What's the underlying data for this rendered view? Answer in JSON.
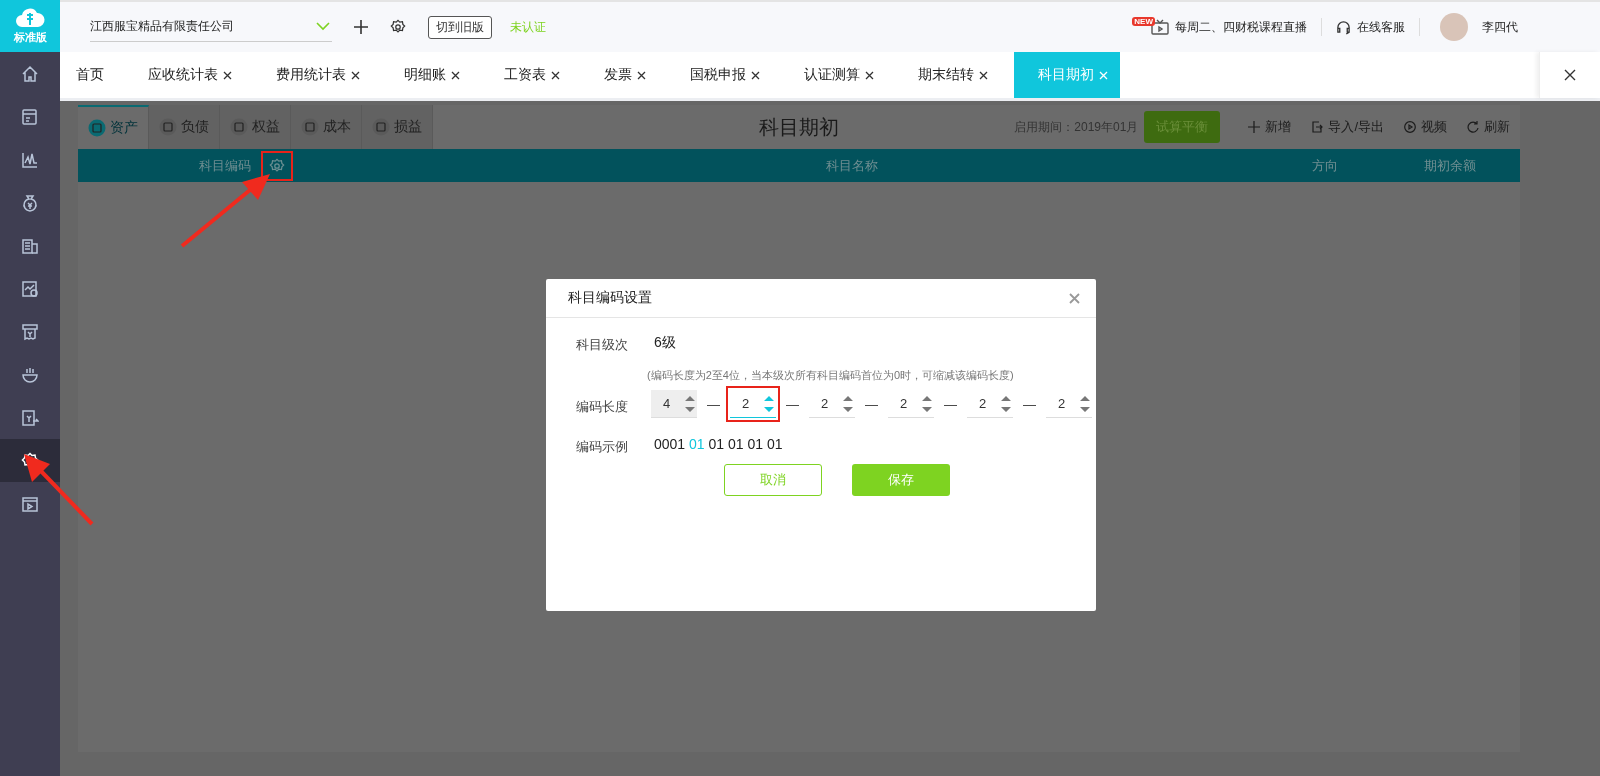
{
  "logo": {
    "label": "标准版"
  },
  "header": {
    "company": "江西服宝精品有限责任公司",
    "switch_button": "切到旧版",
    "auth_status": "未认证",
    "live_badge": "NEW",
    "live_text": "每周二、四财税课程直播",
    "service": "在线客服",
    "user": "李四代"
  },
  "sidebar": {
    "items": [
      {
        "selected": false
      },
      {
        "selected": false
      },
      {
        "selected": false
      },
      {
        "selected": false
      },
      {
        "selected": false
      },
      {
        "selected": false
      },
      {
        "selected": false
      },
      {
        "selected": false
      },
      {
        "selected": false
      },
      {
        "selected": true
      },
      {
        "selected": false
      }
    ]
  },
  "tabs": [
    {
      "label": "首页",
      "closable": false,
      "selected": false
    },
    {
      "label": "应收统计表",
      "closable": true,
      "selected": false
    },
    {
      "label": "费用统计表",
      "closable": true,
      "selected": false
    },
    {
      "label": "明细账",
      "closable": true,
      "selected": false
    },
    {
      "label": "工资表",
      "closable": true,
      "selected": false
    },
    {
      "label": "发票",
      "closable": true,
      "selected": false
    },
    {
      "label": "国税申报",
      "closable": true,
      "selected": false
    },
    {
      "label": "认证测算",
      "closable": true,
      "selected": false
    },
    {
      "label": "期末结转",
      "closable": true,
      "selected": false
    },
    {
      "label": "科目期初",
      "closable": true,
      "selected": true
    }
  ],
  "category_tabs": [
    {
      "label": "资产",
      "selected": true
    },
    {
      "label": "负债",
      "selected": false
    },
    {
      "label": "权益",
      "selected": false
    },
    {
      "label": "成本",
      "selected": false
    },
    {
      "label": "损益",
      "selected": false
    }
  ],
  "page_title": "科目期初",
  "toolbar": {
    "period": "启用期间：2019年01月",
    "balance_button": "试算平衡",
    "actions": [
      "新增",
      "导入/导出",
      "视频",
      "刷新"
    ]
  },
  "table": {
    "columns": [
      "科目编码",
      "科目名称",
      "方向",
      "期初余额"
    ]
  },
  "dialog": {
    "title": "科目编码设置",
    "level_label": "科目级次",
    "level_value": "6级",
    "hint": "(编码长度为2至4位，当本级次所有科目编码首位为0时，可缩减该编码长度)",
    "length_label": "编码长度",
    "separator": "—",
    "lengths": [
      {
        "value": "4",
        "disabled": true,
        "focused": false
      },
      {
        "value": "2",
        "disabled": false,
        "focused": true
      },
      {
        "value": "2",
        "disabled": false,
        "focused": false
      },
      {
        "value": "2",
        "disabled": false,
        "focused": false
      },
      {
        "value": "2",
        "disabled": false,
        "focused": false
      },
      {
        "value": "2",
        "disabled": false,
        "focused": false
      }
    ],
    "example_label": "编码示例",
    "example": [
      {
        "text": "0001",
        "highlighted": false
      },
      {
        "text": "01",
        "highlighted": true
      },
      {
        "text": "01",
        "highlighted": false
      },
      {
        "text": "01",
        "highlighted": false
      },
      {
        "text": "01",
        "highlighted": false
      },
      {
        "text": "01",
        "highlighted": false
      }
    ],
    "cancel": "取消",
    "save": "保存"
  }
}
